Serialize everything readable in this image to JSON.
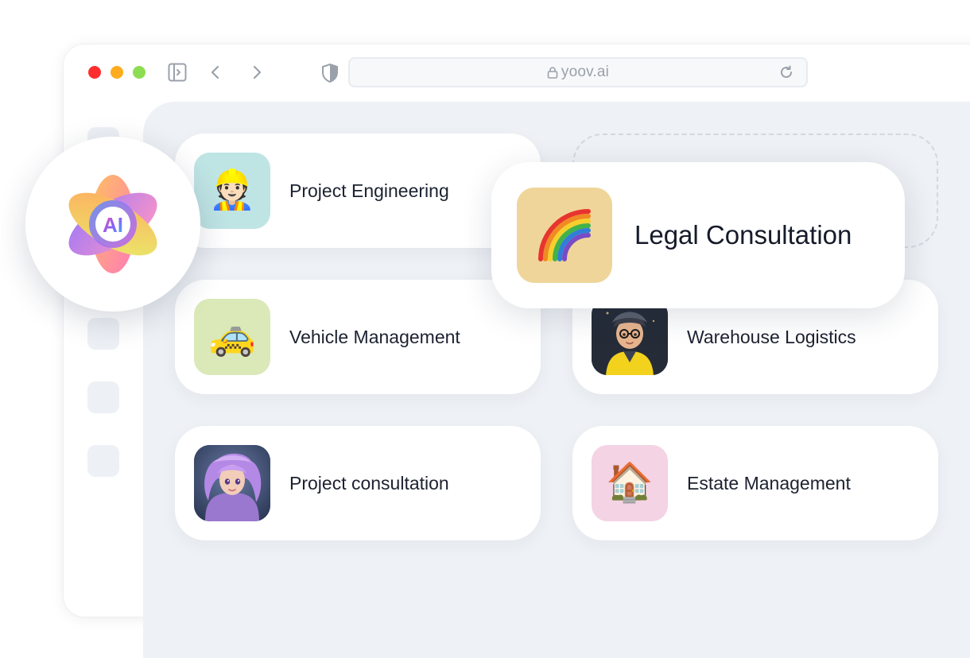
{
  "browser": {
    "url": "yoov.ai",
    "controls": {
      "close": "close-button",
      "minimize": "minimize-button",
      "maximize": "maximize-button"
    },
    "colors": {
      "close": "#fe2e2e",
      "minimize": "#fdab1f",
      "maximize": "#8ddd52"
    },
    "icons": [
      "sidebar-toggle-icon",
      "back-arrow-icon",
      "forward-arrow-icon",
      "shield-icon",
      "lock-icon",
      "reload-icon"
    ]
  },
  "ai_badge": {
    "text": "AI",
    "icon": "ai-flower-logo"
  },
  "cards": [
    {
      "label": "Project Engineering",
      "icon": "construction-worker",
      "tile_color": "#bfe4e4"
    },
    {
      "label": "Vehicle Management",
      "icon": "taxi",
      "tile_color": "#dbe8b8"
    },
    {
      "label": "Warehouse Logistics",
      "icon": "character-yellow-jacket",
      "tile_color": "#2c3440"
    },
    {
      "label": "Project consultation",
      "icon": "character-purple-hair",
      "tile_color": "#3a4a68"
    },
    {
      "label": "Estate Management",
      "icon": "house",
      "tile_color": "#f4d3e4"
    }
  ],
  "featured": {
    "label": "Legal Consultation",
    "icon": "rainbow",
    "tile_color": "#f0d59a"
  }
}
